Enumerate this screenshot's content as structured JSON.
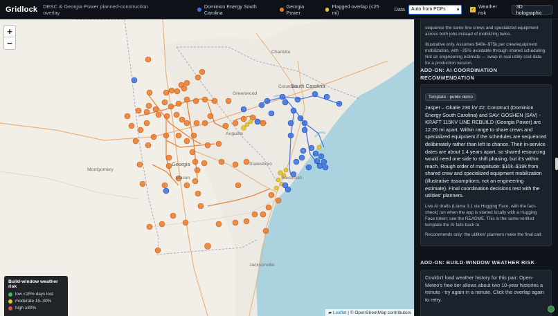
{
  "header": {
    "brand": "Gridlock",
    "subtitle": "DESC & Georgia Power planned-construction overlay",
    "legend": [
      {
        "label": "Dominion Energy South Carolina",
        "color": "#3b6fe0"
      },
      {
        "label": "Georgia Power",
        "color": "#e87b2c"
      },
      {
        "label": "Flagged overlap (<25 mi)",
        "color": "#e6c23a"
      }
    ],
    "data_label": "Data",
    "data_select_value": "Auto from PDFs",
    "weather_risk_label": "Weather risk",
    "holographic_label": "3D holographic"
  },
  "map": {
    "state_labels": [
      "Georgia",
      "South Carolina"
    ],
    "cities": [
      "Charlotte",
      "Greenwood",
      "Columbia",
      "Augusta",
      "Macon",
      "Montgomery",
      "Statesboro",
      "Savannah",
      "Jacksonville"
    ],
    "zoom_in": "+",
    "zoom_out": "−",
    "attribution_leaflet": "Leaflet",
    "attribution_rest": " | © OpenStreetMap contributors",
    "risk_legend": {
      "title": "Build-window weather risk",
      "items": [
        {
          "label": "low <15% days lost",
          "color": "#3fbf5a"
        },
        {
          "label": "moderate 15–30%",
          "color": "#e6c23a"
        },
        {
          "label": "high ≥30%",
          "color": "#e0523a"
        }
      ]
    }
  },
  "panel": {
    "top_card_text_1": "sequence the same line crews and specialized equipment across both jobs instead of mobilizing twice.",
    "top_card_text_2": "Illustrative only. Assumes $40k–$75k per crew/equipment mobilization, with ~25% avoidable through shared scheduling. Not an engineering estimate — swap in real utility cost data for a production version.",
    "ai_heading": "ADD-ON: AI COORDINATION RECOMMENDATION",
    "ai_badge": "Template · public demo",
    "ai_body": "Jasper – Okatie 230 kV #2: Construct (Dominion Energy South Carolina) and SAV: GOSHEN (SAV) - KRAFT 115KV LINE REBUILD (Georgia Power) are 12.26 mi apart. Within range to share crews and specialized equipment if the schedules are sequenced deliberately rather than left to chance. Their in-service dates are about 1.4 years apart, so shared resourcing would need one side to shift phasing, but it's within reach. Rough order of magnitude: $10k–$19k from shared crew and specialized equipment mobilization (illustrative assumptions, not an engineering estimate). Final coordination decisions rest with the utilities' planners.",
    "ai_note": "Live AI drafts (Llama 3.1 via Hugging Face, with the fact-check) run when the app is started locally with a Hugging Face token; see the README. This is the same verified template the AI falls back to.",
    "ai_recommend": "Recommends only: the utilities' planners make the final call.",
    "weather_heading": "ADD-ON: BUILD-WINDOW WEATHER RISK",
    "weather_body": "Couldn't load weather history for this pair: Open-Meteo's free tier allows about two 10-year histories a minute - try again in a minute. Click the overlap again to retry."
  }
}
